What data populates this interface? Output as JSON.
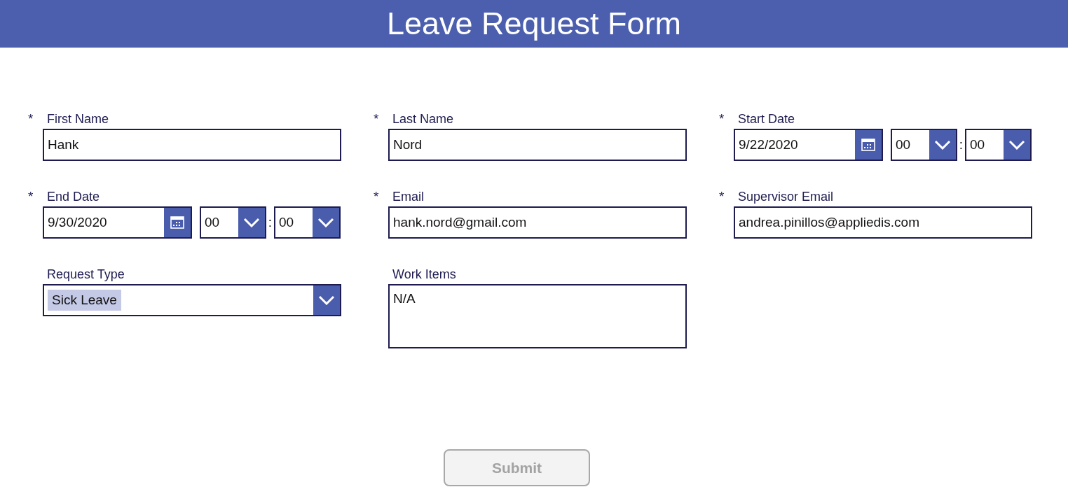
{
  "header": {
    "title": "Leave Request Form"
  },
  "fields": [
    {
      "kind": "text",
      "label": "First Name",
      "asterisk": "*",
      "value": "Hank"
    },
    {
      "kind": "text",
      "label": "Last Name",
      "asterisk": "*",
      "value": "Nord"
    },
    {
      "kind": "datetime",
      "label": "Start Date",
      "asterisk": "*",
      "date": "9/22/2020",
      "hour": "00",
      "separator": ":",
      "minute": "00"
    },
    {
      "kind": "datetime",
      "label": "End Date",
      "asterisk": "*",
      "date": "9/30/2020",
      "hour": "00",
      "separator": ":",
      "minute": "00"
    },
    {
      "kind": "text",
      "label": "Email",
      "asterisk": "*",
      "value": "hank.nord@gmail.com"
    },
    {
      "kind": "text",
      "label": "Supervisor Email",
      "asterisk": "*",
      "value": "andrea.pinillos@appliedis.com"
    },
    {
      "kind": "dropdown",
      "label": "Request Type",
      "value": "Sick Leave",
      "highlighted": true
    },
    {
      "kind": "textarea",
      "label": "Work Items",
      "value": "N/A"
    }
  ],
  "submit": {
    "label": "Submit",
    "disabled": true
  }
}
